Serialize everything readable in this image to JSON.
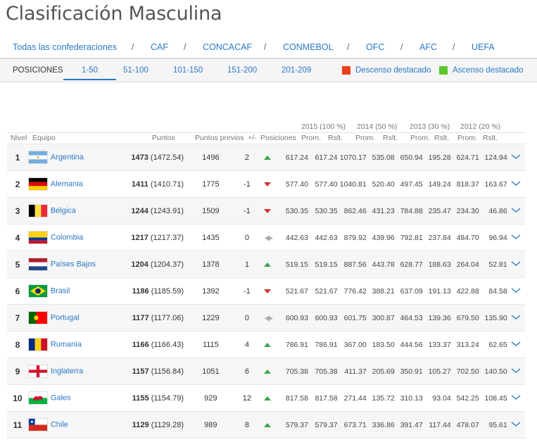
{
  "page": {
    "title": "Clasificación Masculina"
  },
  "confederations": [
    "Todas las confederaciones",
    "CAF",
    "CONCACAF",
    "CONMEBOL",
    "OFC",
    "AFC",
    "UEFA"
  ],
  "separator": "/",
  "tabs": {
    "label": "POSICIONES",
    "items": [
      "1-50",
      "51-100",
      "101-150",
      "151-200",
      "201-209"
    ],
    "active": "1-50",
    "legend_down": "Descenso destacado",
    "legend_up": "Ascenso destacado",
    "color_down": "#e8401c",
    "color_up": "#5ec42e"
  },
  "table": {
    "groups": [
      "2015 (100 %)",
      "2014 (50 %)",
      "2013 (30 %)",
      "2012 (20 %)"
    ],
    "headers": {
      "nivel": "Nivel",
      "equipo": "Equipo",
      "puntos": "Puntos",
      "previos": "Puntos previos",
      "diff": "+/-",
      "posiciones": "Posiciones",
      "prom": "Prom.",
      "rslt": "Rslt."
    },
    "rows": [
      {
        "pos": "1",
        "team": "Argentina",
        "flag": "arg",
        "pts": "1473",
        "pts_exact": "(1472.54)",
        "prev": "1496",
        "diff": "2",
        "trend": "up",
        "y": [
          "617.24",
          "617.24",
          "1070.17",
          "535.08",
          "650.94",
          "195.28",
          "624.71",
          "124.94"
        ]
      },
      {
        "pos": "2",
        "team": "Alemania",
        "flag": "ger",
        "pts": "1411",
        "pts_exact": "(1410.71)",
        "prev": "1775",
        "diff": "-1",
        "trend": "down",
        "y": [
          "577.40",
          "577.40",
          "1040.81",
          "520.40",
          "497.45",
          "149.24",
          "818.37",
          "163.67"
        ]
      },
      {
        "pos": "3",
        "team": "Bélgica",
        "flag": "bel",
        "pts": "1244",
        "pts_exact": "(1243.91)",
        "prev": "1509",
        "diff": "-1",
        "trend": "down",
        "y": [
          "530.35",
          "530.35",
          "862.46",
          "431.23",
          "784.88",
          "235.47",
          "234.30",
          "46.86"
        ]
      },
      {
        "pos": "4",
        "team": "Colombia",
        "flag": "col",
        "pts": "1217",
        "pts_exact": "(1217.37)",
        "prev": "1435",
        "diff": "0",
        "trend": "same",
        "y": [
          "442.63",
          "442.63",
          "879.92",
          "439.96",
          "792.81",
          "237.84",
          "484.70",
          "96.94"
        ]
      },
      {
        "pos": "5",
        "team": "Países Bajos",
        "flag": "ned",
        "pts": "1204",
        "pts_exact": "(1204.37)",
        "prev": "1378",
        "diff": "1",
        "trend": "up",
        "y": [
          "519.15",
          "519.15",
          "887.56",
          "443.78",
          "628.77",
          "188.63",
          "264.04",
          "52.81"
        ]
      },
      {
        "pos": "6",
        "team": "Brasil",
        "flag": "bra",
        "pts": "1186",
        "pts_exact": "(1185.59)",
        "prev": "1392",
        "diff": "-1",
        "trend": "down",
        "y": [
          "521.67",
          "521.67",
          "776.42",
          "388.21",
          "637.09",
          "191.13",
          "422.88",
          "84.58"
        ]
      },
      {
        "pos": "7",
        "team": "Portugal",
        "flag": "por",
        "pts": "1177",
        "pts_exact": "(1177.06)",
        "prev": "1229",
        "diff": "0",
        "trend": "same",
        "y": [
          "600.93",
          "600.93",
          "601.75",
          "300.87",
          "464.53",
          "139.36",
          "679.50",
          "135.90"
        ]
      },
      {
        "pos": "8",
        "team": "Rumania",
        "flag": "rou",
        "pts": "1166",
        "pts_exact": "(1166.43)",
        "prev": "1115",
        "diff": "4",
        "trend": "up",
        "y": [
          "786.91",
          "786.91",
          "367.00",
          "183.50",
          "444.56",
          "133.37",
          "313.24",
          "62.65"
        ]
      },
      {
        "pos": "9",
        "team": "Inglaterra",
        "flag": "eng",
        "pts": "1157",
        "pts_exact": "(1156.84)",
        "prev": "1051",
        "diff": "6",
        "trend": "up",
        "y": [
          "705.38",
          "705.38",
          "411.37",
          "205.69",
          "350.91",
          "105.27",
          "702.50",
          "140.50"
        ]
      },
      {
        "pos": "10",
        "team": "Gales",
        "flag": "wal",
        "pts": "1155",
        "pts_exact": "(1154.79)",
        "prev": "929",
        "diff": "12",
        "trend": "up",
        "y": [
          "817.58",
          "817.58",
          "271.44",
          "135.72",
          "310.13",
          "93.04",
          "542.25",
          "108.45"
        ]
      },
      {
        "pos": "11",
        "team": "Chile",
        "flag": "chi",
        "pts": "1129",
        "pts_exact": "(1129.28)",
        "prev": "989",
        "diff": "8",
        "trend": "up",
        "y": [
          "579.37",
          "579.37",
          "673.71",
          "336.86",
          "391.47",
          "117.44",
          "478.07",
          "95.61"
        ]
      }
    ]
  }
}
